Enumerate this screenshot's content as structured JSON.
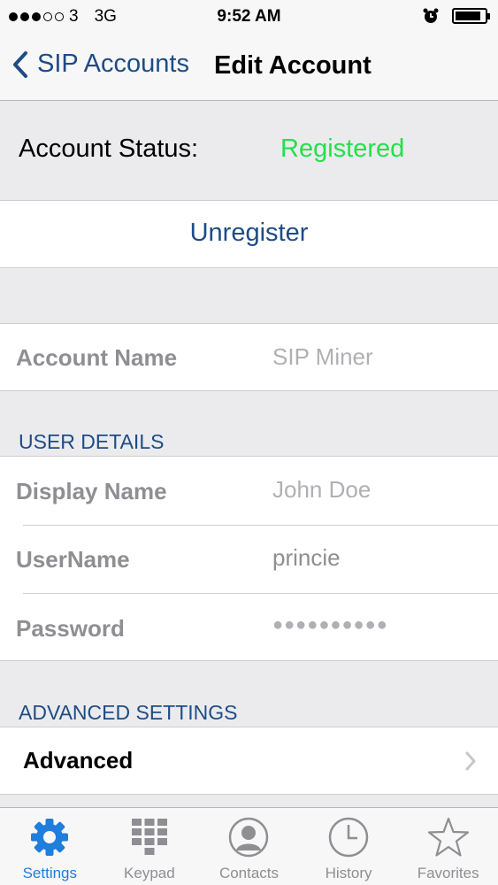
{
  "status_bar": {
    "signal_dots_filled": 3,
    "signal_dots_total": 5,
    "carrier": "3",
    "network": "3G",
    "time": "9:52 AM",
    "battery_level": 0.75
  },
  "nav": {
    "back_label": "SIP Accounts",
    "title": "Edit Account"
  },
  "account_status": {
    "label": "Account Status:",
    "value": "Registered",
    "value_color": "#22e04a"
  },
  "unregister_label": "Unregister",
  "account_name": {
    "label": "Account Name",
    "placeholder": "SIP Miner"
  },
  "user_details": {
    "header": "USER DETAILS",
    "display_name_label": "Display Name",
    "display_name_placeholder": "John Doe",
    "username_label": "UserName",
    "username_value": "princie",
    "password_label": "Password",
    "password_value": "●●●●●●●●●●"
  },
  "advanced_settings": {
    "header": "ADVANCED SETTINGS",
    "advanced_label": "Advanced"
  },
  "tabs": [
    {
      "label": "Settings",
      "icon": "gear-icon",
      "active": true
    },
    {
      "label": "Keypad",
      "icon": "keypad-icon",
      "active": false
    },
    {
      "label": "Contacts",
      "icon": "contacts-icon",
      "active": false
    },
    {
      "label": "History",
      "icon": "clock-icon",
      "active": false
    },
    {
      "label": "Favorites",
      "icon": "star-icon",
      "active": false
    }
  ],
  "colors": {
    "accent": "#1f7ddb",
    "nav_text": "#1e4c86",
    "status_green": "#22e04a"
  }
}
